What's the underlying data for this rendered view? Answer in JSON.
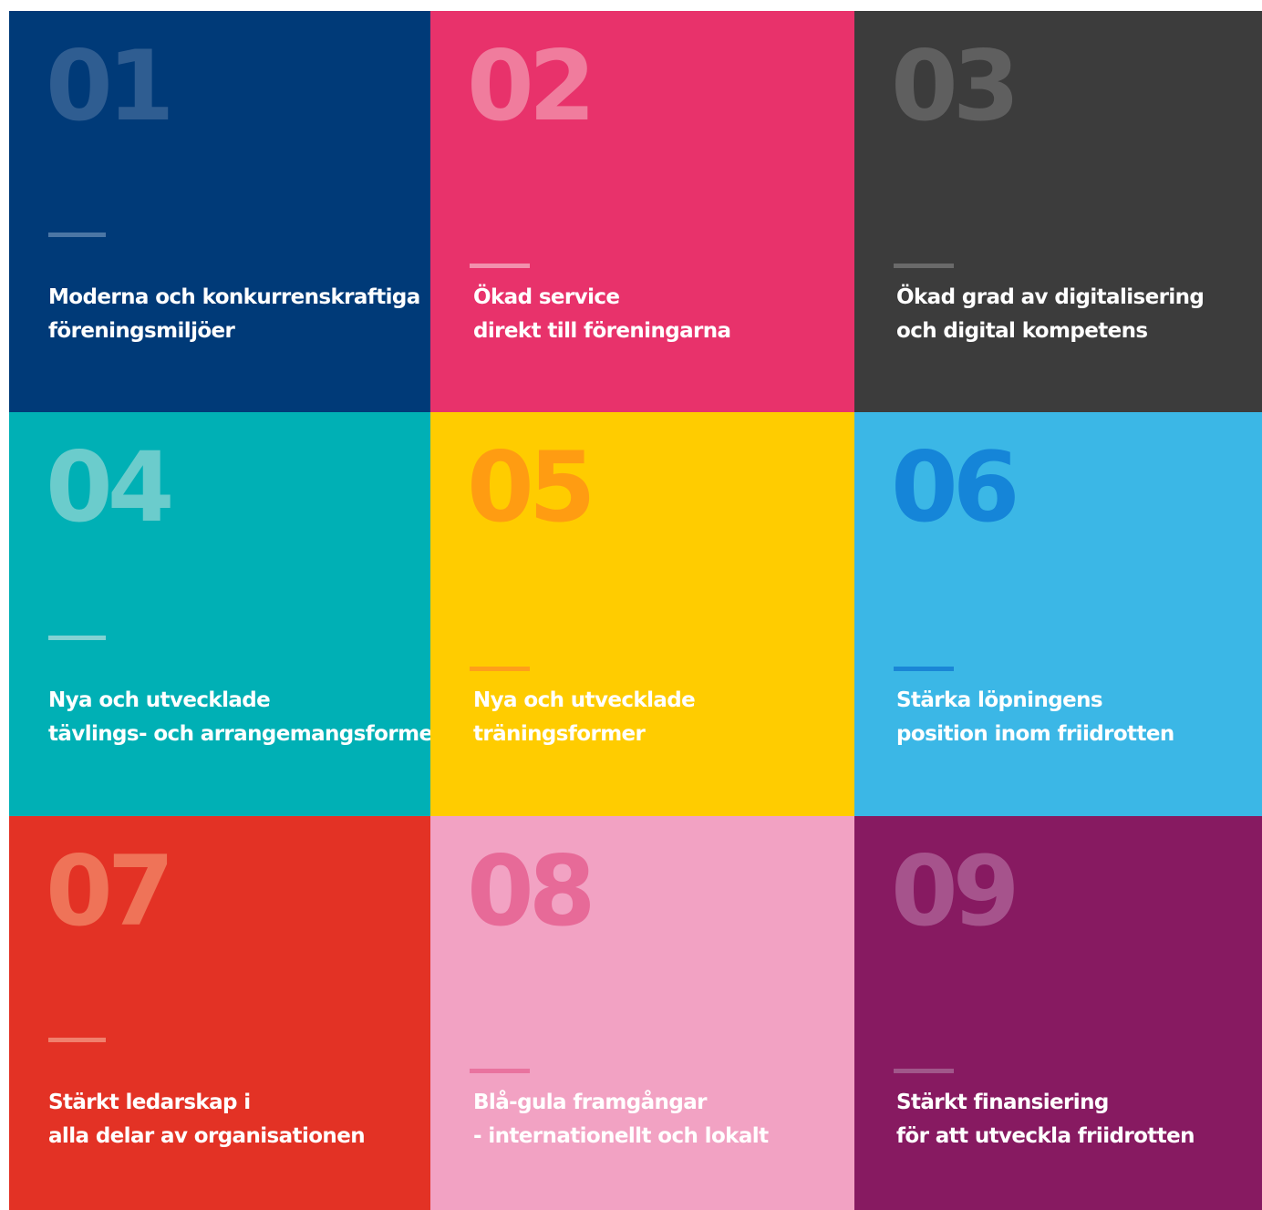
{
  "tiles": [
    {
      "number": "01",
      "line1": "Moderna och konkurrenskraftiga",
      "line2": "föreningsmiljöer",
      "bg": "#003a78",
      "num_color": "#2f5d91",
      "dash_color": "#4b76a5",
      "text_color": "#ffffff"
    },
    {
      "number": "02",
      "line1": "Ökad service",
      "line2": "direkt till föreningarna",
      "bg": "#e8326b",
      "num_color": "#f07c9d",
      "dash_color": "#f290ad",
      "text_color": "#ffffff"
    },
    {
      "number": "03",
      "line1": "Ökad grad av digitalisering",
      "line2": "och digital kompetens",
      "bg": "#3c3c3c",
      "num_color": "#5f5f5f",
      "dash_color": "#6a6a6a",
      "text_color": "#ffffff"
    },
    {
      "number": "04",
      "line1": "Nya och utvecklade",
      "line2": "tävlings- och arrangemangsformer",
      "bg": "#00b0b5",
      "num_color": "#6bcccc",
      "dash_color": "#82d2d3",
      "text_color": "#ffffff"
    },
    {
      "number": "05",
      "line1": "Nya och utvecklade",
      "line2": "träningsformer",
      "bg": "#ffcc00",
      "num_color": "#ff9c12",
      "dash_color": "#ff9f1a",
      "text_color": "#ffffff"
    },
    {
      "number": "06",
      "line1": "Stärka löpningens",
      "line2": "position inom friidrotten",
      "bg": "#3bb7e6",
      "num_color": "#1585d8",
      "dash_color": "#1a86d6",
      "text_color": "#ffffff"
    },
    {
      "number": "07",
      "line1": "Stärkt ledarskap i",
      "line2": "alla delar av organisationen",
      "bg": "#e33225",
      "num_color": "#ef7358",
      "dash_color": "#f0806d",
      "text_color": "#ffffff"
    },
    {
      "number": "08",
      "line1": "Blå-gula framgångar",
      "line2": "- internationellt och lokalt",
      "bg": "#f2a2c3",
      "num_color": "#e76a98",
      "dash_color": "#e9739f",
      "text_color": "#ffffff"
    },
    {
      "number": "09",
      "line1": "Stärkt finansiering",
      "line2": "för att utveckla friidrotten",
      "bg": "#871a61",
      "num_color": "#a6538c",
      "dash_color": "#a0578a",
      "text_color": "#ffffff"
    }
  ]
}
